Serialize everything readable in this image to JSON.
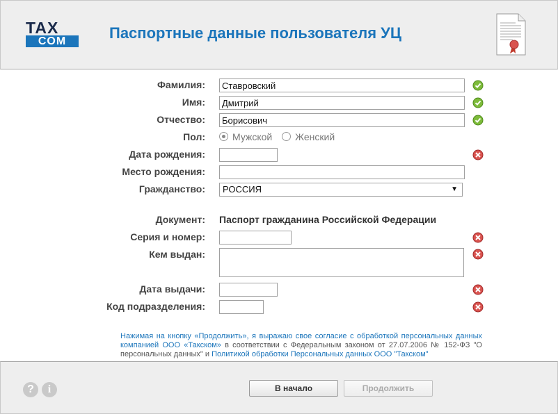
{
  "header": {
    "logo_top": "TAX",
    "logo_bottom": "COM",
    "title": "Паспортные данные пользователя УЦ"
  },
  "form": {
    "surname": {
      "label": "Фамилия:",
      "value": "Ставровский",
      "status": "ok"
    },
    "name": {
      "label": "Имя:",
      "value": "Дмитрий",
      "status": "ok"
    },
    "patronymic": {
      "label": "Отчество:",
      "value": "Борисович",
      "status": "ok"
    },
    "gender": {
      "label": "Пол:",
      "options": [
        "Мужской",
        "Женский"
      ],
      "selected": "Мужской"
    },
    "birth_date": {
      "label": "Дата рождения:",
      "value": "",
      "status": "error"
    },
    "birth_place": {
      "label": "Место рождения:",
      "value": ""
    },
    "citizenship": {
      "label": "Гражданство:",
      "value": "РОССИЯ"
    },
    "document": {
      "label": "Документ:",
      "value": "Паспорт гражданина Российской Федерации"
    },
    "series_number": {
      "label": "Серия и номер:",
      "value": "",
      "status": "error"
    },
    "issued_by": {
      "label": "Кем выдан:",
      "value": "",
      "status": "error"
    },
    "issue_date": {
      "label": "Дата выдачи:",
      "value": "",
      "status": "error"
    },
    "dept_code": {
      "label": "Код подразделения:",
      "value": "",
      "status": "error"
    }
  },
  "consent": {
    "part1": "Нажимая на кнопку «Продолжить», я выражаю свое согласие с обработкой персональных данных компанией ООО «Такском»",
    "part2": " в соответствии с Федеральным законом от 27.07.2006 № 152-ФЗ \"О персональных данных\" и ",
    "part3": "Политикой обработки Персональных данных ООО \"Такском\""
  },
  "footer": {
    "help_icon": "question-icon",
    "info_icon": "info-icon",
    "back_label": "В начало",
    "continue_label": "Продолжить"
  },
  "colors": {
    "accent": "#1b75bb",
    "ok": "#6aaa28",
    "error": "#c0392b"
  }
}
